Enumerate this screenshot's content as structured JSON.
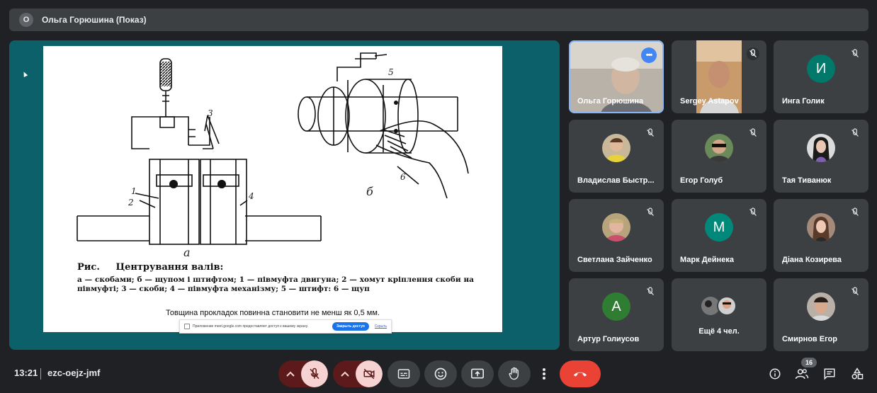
{
  "presenter": {
    "badge": "О",
    "title": "Ольга Горюшина (Показ)"
  },
  "slide": {
    "label_a": "а",
    "label_b": "б",
    "callouts": [
      "1",
      "2",
      "3",
      "4",
      "5",
      "6"
    ],
    "caption_prefix": "Рис.",
    "caption_title": "Центрування валів:",
    "caption_text": "а — скобами; б — щупом і штифтом; 1 — півмуфта двигуна; 2 — хомут кріплення скоби на півмуфті; 3 — скоби; 4 — півмуфта механізму; 5 — штифт: 6 — щуп",
    "note": "Товщина прокладок повинна становити не менш як 0,5 мм."
  },
  "share_bar": {
    "message": "Приложение meet.google.com предоставляет доступ к вашему экрану.",
    "stop_label": "Закрыть доступ",
    "hide_label": "Скрыть"
  },
  "participants": [
    {
      "name": "Ольга Горюшина",
      "kind": "video"
    },
    {
      "name": "Sergey Astapov",
      "kind": "video"
    },
    {
      "name": "Инга Голик",
      "kind": "letter",
      "letter": "И",
      "color": "#00796b"
    },
    {
      "name": "Владислав Быстр...",
      "kind": "photo"
    },
    {
      "name": "Егор Голуб",
      "kind": "photo"
    },
    {
      "name": "Тая Тиванюк",
      "kind": "photo"
    },
    {
      "name": "Светлана Зайченко",
      "kind": "photo"
    },
    {
      "name": "Марк Дейнека",
      "kind": "letter",
      "letter": "М",
      "color": "#00897b"
    },
    {
      "name": "Діана Козирева",
      "kind": "photo"
    },
    {
      "name": "Артур Голиусов",
      "kind": "letter",
      "letter": "А",
      "color": "#2e7d32"
    },
    {
      "name": "Ещё 4 чел.",
      "kind": "group"
    },
    {
      "name": "Смирнов Егор",
      "kind": "photo"
    }
  ],
  "bottom": {
    "time": "13:21",
    "meeting_code": "ezc-oejz-jmf",
    "participants_count": "16"
  },
  "colors": {
    "end_call": "#ea4335",
    "accent": "#8ab4f8",
    "muted_bg": "#f6d3d2"
  }
}
